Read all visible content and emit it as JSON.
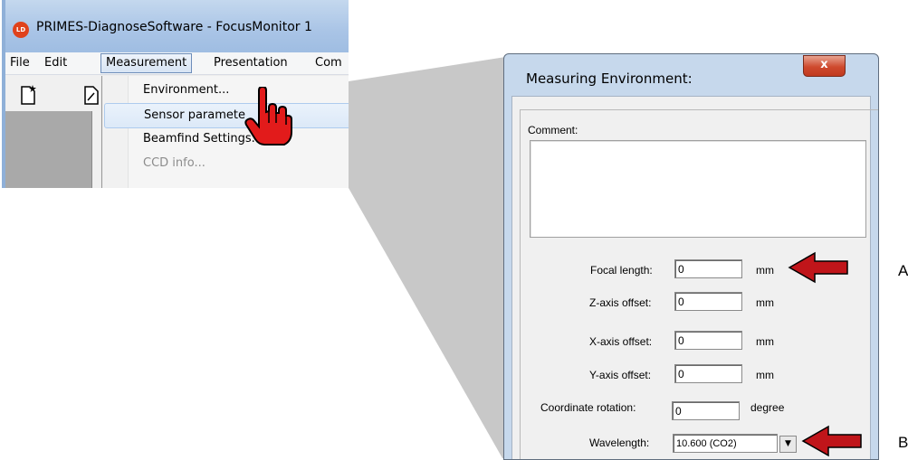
{
  "window": {
    "logo_text": "LD",
    "title": "PRIMES-DiagnoseSoftware - FocusMonitor 1",
    "menu": [
      "File",
      "Edit",
      "Measurement",
      "Presentation",
      "Com"
    ],
    "dropdown": [
      {
        "label": "Environment...",
        "enabled": true,
        "highlighted": false
      },
      {
        "label": "Sensor paramete",
        "enabled": true,
        "highlighted": true
      },
      {
        "label": "Beamfind Settings...",
        "enabled": true,
        "highlighted": false
      },
      {
        "label": "CCD info...",
        "enabled": false,
        "highlighted": false
      }
    ]
  },
  "dialog": {
    "title": "Measuring Environment:",
    "close_glyph": "x",
    "comment_label": "Comment:",
    "comment_value": "",
    "fields": [
      {
        "label": "Focal length:",
        "value": "0",
        "unit": "mm"
      },
      {
        "label": "Z-axis offset:",
        "value": "0",
        "unit": "mm"
      },
      {
        "label": "X-axis offset:",
        "value": "0",
        "unit": "mm"
      },
      {
        "label": "Y-axis offset:",
        "value": "0",
        "unit": "mm"
      },
      {
        "label": "Coordinate rotation:",
        "value": "0",
        "unit": "degree"
      }
    ],
    "wavelength": {
      "label": "Wavelength:",
      "value": "10.600 (CO2)",
      "arrow": "▼"
    }
  },
  "annotations": {
    "a": "A",
    "b": "B"
  },
  "colors": {
    "pointer_arrow": "#c0151a",
    "title_gradient": "#a9c4e6",
    "close_button": "#cf4a2e"
  }
}
